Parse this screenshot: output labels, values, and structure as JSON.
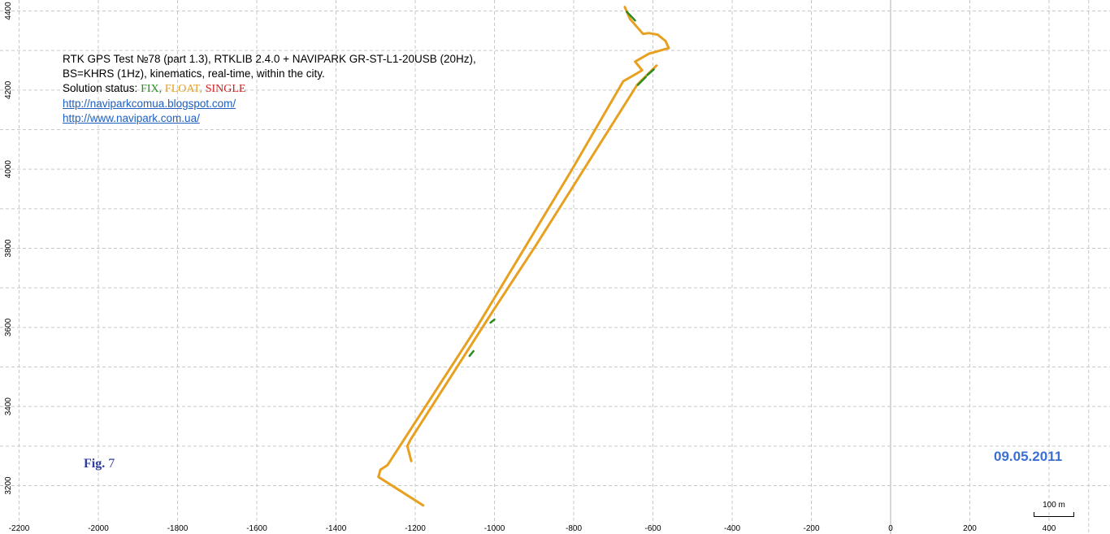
{
  "chart_data": {
    "type": "line",
    "title_lines": [
      "RTK GPS Test №78 (part 1.3), RTKLIB 2.4.0 + NAVIPARK GR-ST-L1-20USB (20Hz),",
      "BS=KHRS (1Hz), kinematics, real-time, within the city."
    ],
    "status_label": "Solution status:",
    "status_items": [
      {
        "label": "FIX,",
        "color": "#2e8b22"
      },
      {
        "label": "FLOAT,",
        "color": "#e8a020"
      },
      {
        "label": "SINGLE",
        "color": "#cc2222"
      }
    ],
    "links": [
      "http://naviparkcomua.blogspot.com/",
      "http://www.navipark.com.ua/"
    ],
    "figure_label_bold": "Fig.",
    "figure_label_num": "7",
    "date": "09.05.2011",
    "scale_label": "100 m",
    "xlim": [
      -2200,
      550
    ],
    "ylim": [
      3150,
      4410
    ],
    "x_ticks": [
      -2200,
      -2000,
      -1800,
      -1600,
      -1400,
      -1200,
      -1000,
      -800,
      -600,
      -400,
      -200,
      0,
      200,
      400
    ],
    "y_ticks": [
      3200,
      3400,
      3600,
      3800,
      4000,
      4200,
      4400
    ],
    "grid": true,
    "colors": {
      "fix": "#2e8b22",
      "float": "#e8a020",
      "single": "#cc2222",
      "grid": "#c8c8c8",
      "axis": "#b0b0b0"
    },
    "series": [
      {
        "status": "float",
        "x": [
          -1180,
          -1293,
          -1288,
          -1270,
          -1045,
          -805,
          -675,
          -627,
          -645,
          -610,
          -560,
          -568,
          -588,
          -610,
          -625,
          -658,
          -671
        ],
        "y": [
          3150,
          3222,
          3240,
          3252,
          3600,
          3998,
          4222,
          4250,
          4272,
          4292,
          4306,
          4324,
          4340,
          4344,
          4342,
          4380,
          4410
        ]
      },
      {
        "status": "float",
        "x": [
          -1210,
          -1220,
          -1212,
          -1005,
          -895,
          -640,
          -591
        ],
        "y": [
          3262,
          3300,
          3316,
          3640,
          3808,
          4213,
          4262
        ]
      },
      {
        "status": "fix",
        "x": [
          -645,
          -666
        ],
        "y": [
          4376,
          4398
        ]
      },
      {
        "status": "fix",
        "x": [
          -638,
          -618
        ],
        "y": [
          4213,
          4233
        ]
      },
      {
        "status": "fix",
        "x": [
          -1063,
          -1053
        ],
        "y": [
          3528,
          3540
        ]
      },
      {
        "status": "fix",
        "x": [
          -1010,
          -1000
        ],
        "y": [
          3612,
          3620
        ]
      },
      {
        "status": "fix",
        "x": [
          -614,
          -598
        ],
        "y": [
          4238,
          4252
        ]
      }
    ]
  }
}
